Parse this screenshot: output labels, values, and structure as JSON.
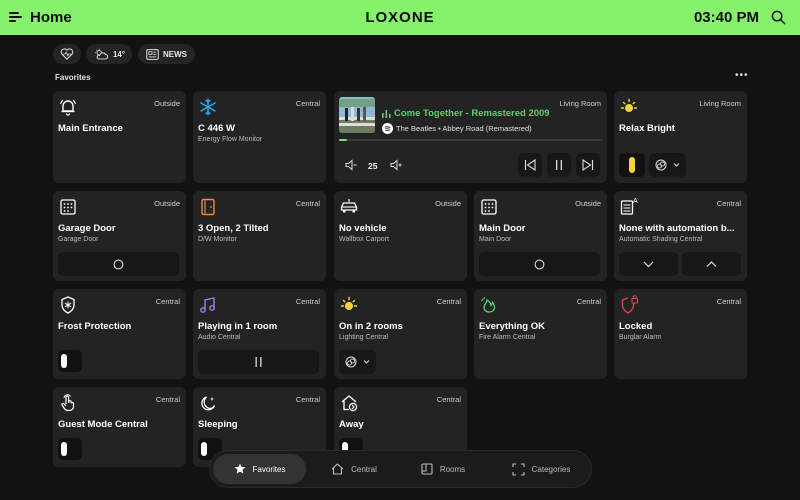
{
  "header": {
    "title": "Home",
    "logo": "LOXONE",
    "time": "03:40 PM",
    "bg_color": "#86f26b"
  },
  "chips": {
    "weather": "14°",
    "news": "NEWS"
  },
  "section": {
    "label": "Favorites"
  },
  "tiles": [
    {
      "title": "Main Entrance",
      "subtitle": "",
      "location": "Outside",
      "icon": "bell-icon"
    },
    {
      "title": "C 446 W",
      "subtitle": "Energy Flow Monitor",
      "location": "Central",
      "icon": "snowflake-icon"
    },
    {
      "title": "Relax Bright",
      "subtitle": "",
      "location": "Living Room",
      "icon": "sun-icon"
    },
    {
      "title": "Garage Door",
      "subtitle": "Garage Door",
      "location": "Outside",
      "icon": "garage-door-icon"
    },
    {
      "title": "3 Open, 2 Tilted",
      "subtitle": "D/W Monitor",
      "location": "Central",
      "icon": "door-icon"
    },
    {
      "title": "No vehicle",
      "subtitle": "Wallbox Carport",
      "location": "Outside",
      "icon": "car-icon"
    },
    {
      "title": "Main Door",
      "subtitle": "Main Door",
      "location": "Outside",
      "icon": "garage-door-icon"
    },
    {
      "title": "None with automation b...",
      "subtitle": "Automatic Shading Central",
      "location": "Central",
      "icon": "shading-icon"
    },
    {
      "title": "Frost Protection",
      "subtitle": "",
      "location": "Central",
      "icon": "shield-snowflake-icon"
    },
    {
      "title": "Playing in 1 room",
      "subtitle": "Audio Central",
      "location": "Central",
      "icon": "music-icon"
    },
    {
      "title": "On in 2 rooms",
      "subtitle": "Lighting Central",
      "location": "Central",
      "icon": "sun-icon"
    },
    {
      "title": "Everything OK",
      "subtitle": "Fire Alarm Central",
      "location": "Central",
      "icon": "fire-alarm-icon"
    },
    {
      "title": "Locked",
      "subtitle": "Burglar Alarm",
      "location": "Central",
      "icon": "shield-lock-icon"
    },
    {
      "title": "Guest Mode Central",
      "subtitle": "",
      "location": "Central",
      "icon": "hand-icon"
    },
    {
      "title": "Sleeping",
      "subtitle": "",
      "location": "Central",
      "icon": "moon-icon"
    },
    {
      "title": "Away",
      "subtitle": "",
      "location": "Central",
      "icon": "away-house-icon"
    }
  ],
  "media": {
    "title": "Come Together - Remastered 2009",
    "artist": "The Beatles • Abbey Road (Remastered)",
    "location": "Living Room",
    "volume": "25",
    "progress": 0.03,
    "accent": "#5ed06a"
  },
  "nav": [
    {
      "label": "Favorites",
      "icon": "star-icon",
      "active": true
    },
    {
      "label": "Central",
      "icon": "house-icon",
      "active": false
    },
    {
      "label": "Rooms",
      "icon": "rooms-icon",
      "active": false
    },
    {
      "label": "Categories",
      "icon": "categories-icon",
      "active": false
    }
  ],
  "colors": {
    "accent": "#86f26b",
    "tile": "#232323",
    "background": "#121212",
    "light_on": "#f5d33b",
    "alarm": "#e0424f"
  }
}
